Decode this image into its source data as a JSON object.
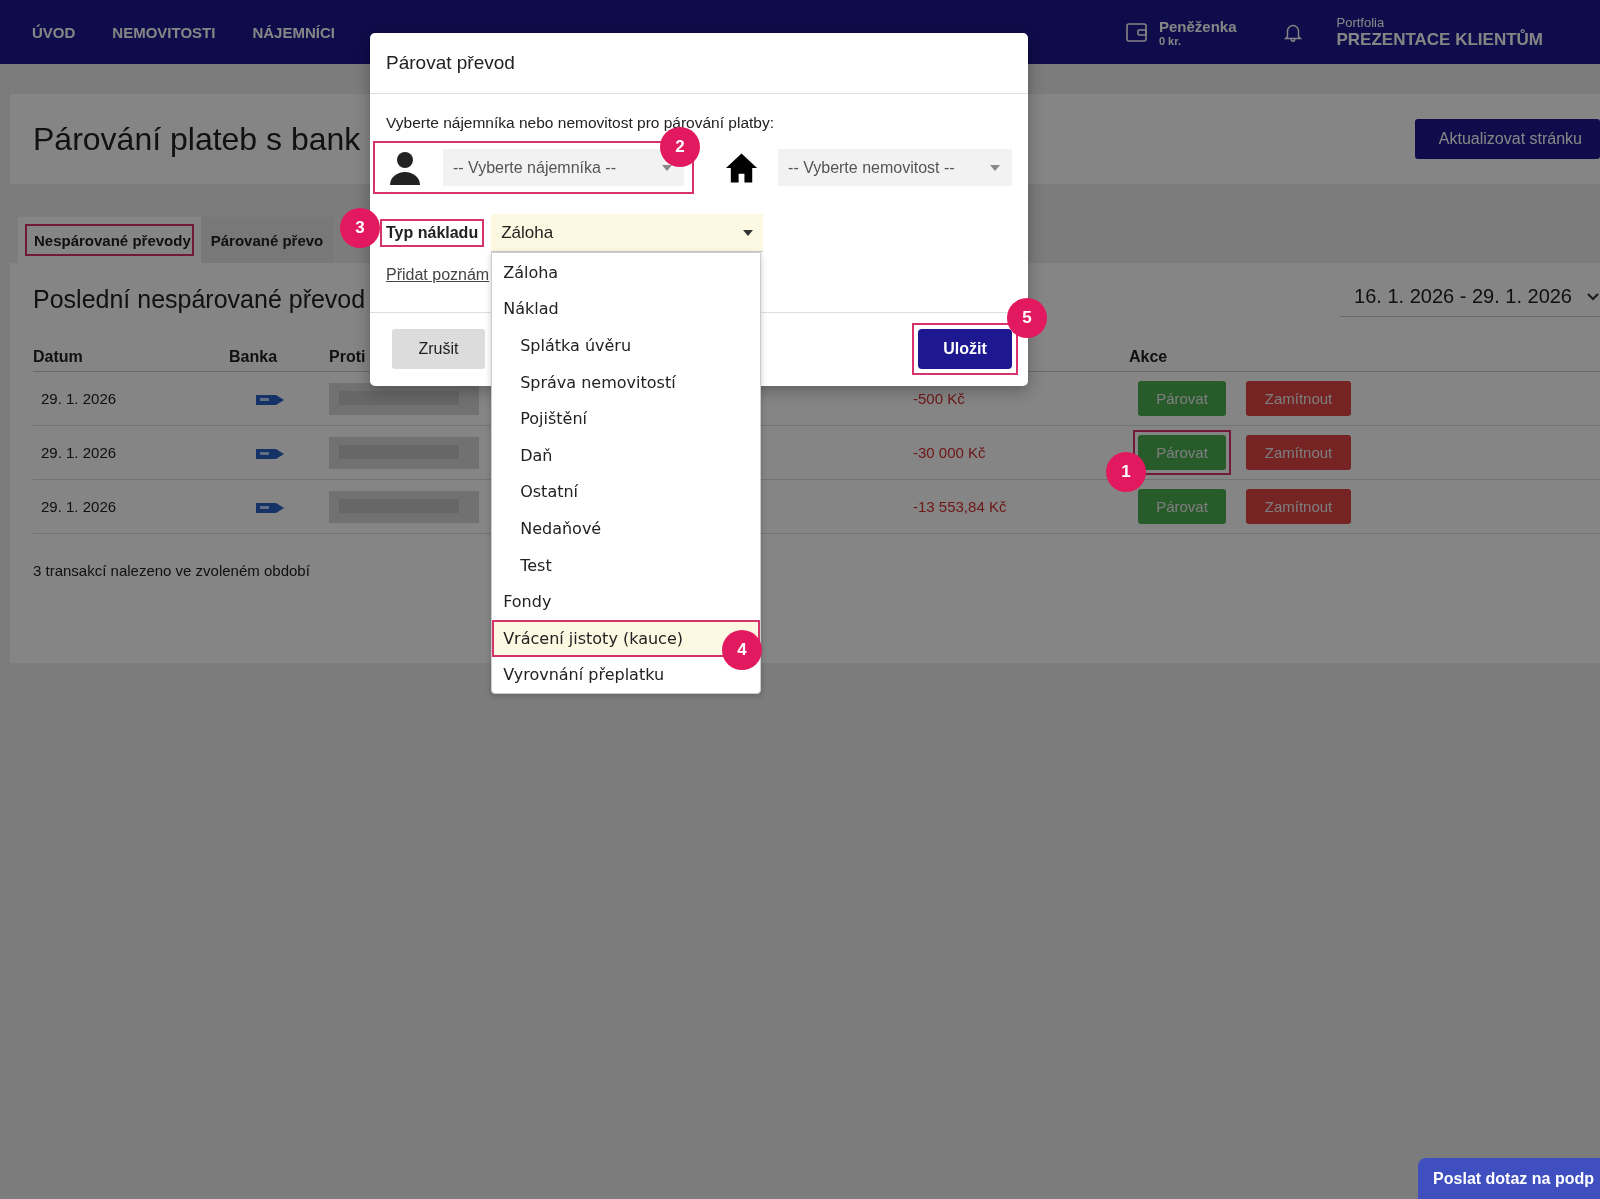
{
  "nav": {
    "items": [
      {
        "label": "ÚVOD"
      },
      {
        "label": "NEMOVITOSTI"
      },
      {
        "label": "NÁJEMNÍCI"
      }
    ],
    "wallet": {
      "label": "Peněženka",
      "balance": "0 kr."
    },
    "portfolio": {
      "caption": "Portfolia",
      "name": "PREZENTACE KLIENTŮM"
    }
  },
  "page": {
    "title": "Párování plateb s bank",
    "refresh_button": "Aktualizovat stránku",
    "tabs": [
      {
        "label": "Nespárované převody",
        "selected": true,
        "highlighted": true
      },
      {
        "label": "Párované převo",
        "selected": false,
        "highlighted": false
      }
    ],
    "section_title": "Poslední nespárované převod",
    "date_range": "16. 1. 2026 - 29. 1. 2026",
    "columns": [
      "Datum",
      "Banka",
      "Proti",
      "Akce"
    ],
    "rows": [
      {
        "date": "29. 1. 2026",
        "amount": "-500 Kč",
        "pair_button": "Párovat",
        "reject_button": "Zamítnout",
        "highlighted": false
      },
      {
        "date": "29. 1. 2026",
        "amount": "-30 000 Kč",
        "pair_button": "Párovat",
        "reject_button": "Zamítnout",
        "highlighted": true
      },
      {
        "date": "29. 1. 2026",
        "amount": "-13 553,84 Kč",
        "pair_button": "Párovat",
        "reject_button": "Zamítnout",
        "highlighted": false
      }
    ],
    "summary": "3 transakcí nalezeno ve zvoleném období"
  },
  "modal": {
    "title": "Párovat převod",
    "prompt": "Vyberte nájemníka nebo nemovitost pro párování platby:",
    "tenant_select": {
      "placeholder": "-- Vyberte nájemníka --",
      "highlighted": true
    },
    "property_select": {
      "placeholder": "-- Vyberte nemovitost --"
    },
    "cost_type": {
      "label": "Typ nákladu",
      "value": "Záloha",
      "highlighted": true,
      "expanded": true,
      "options": [
        {
          "label": "Záloha",
          "highlighted": false
        },
        {
          "label": "Náklad",
          "highlighted": false,
          "children": [
            {
              "label": "Splátka úvěru",
              "highlighted": false
            },
            {
              "label": "Správa nemovitostí",
              "highlighted": false
            },
            {
              "label": "Pojištění",
              "highlighted": false
            },
            {
              "label": "Daň",
              "highlighted": false
            },
            {
              "label": "Ostatní",
              "highlighted": false
            },
            {
              "label": "Nedaňové",
              "highlighted": false
            },
            {
              "label": "Test",
              "highlighted": false
            }
          ]
        },
        {
          "label": "Fondy",
          "highlighted": false
        },
        {
          "label": "Vrácení jistoty (kauce)",
          "highlighted": true
        },
        {
          "label": "Vyrovnání přeplatku",
          "highlighted": false
        }
      ]
    },
    "note_link": "Přidat poznám",
    "cancel_button": "Zrušit",
    "save_button": {
      "label": "Uložit",
      "highlighted": true
    }
  },
  "markers": [
    {
      "number": "1"
    },
    {
      "number": "2"
    },
    {
      "number": "3"
    },
    {
      "number": "4"
    },
    {
      "number": "5"
    }
  ],
  "support_button": "Poslat dotaz na podp"
}
